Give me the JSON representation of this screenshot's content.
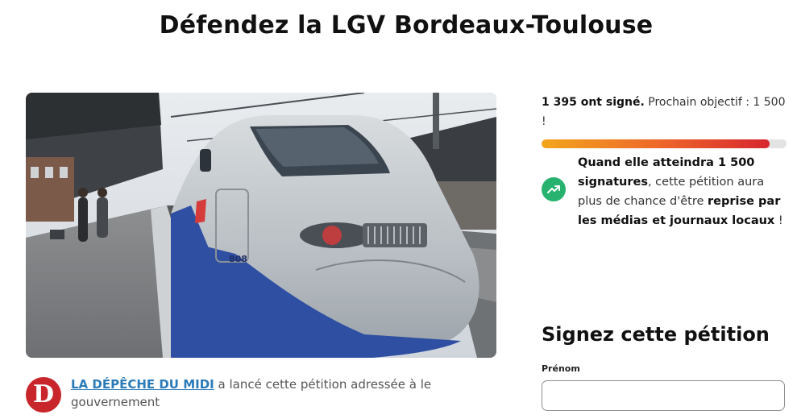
{
  "page": {
    "title": "Défendez la LGV Bordeaux-Toulouse"
  },
  "image": {
    "alt": "TGV à quai en gare",
    "train_number": "808"
  },
  "starter": {
    "logo_letter": "D",
    "organization": "LA DÉPÊCHE DU MIDI",
    "text": " a lancé cette pétition adressée à le gouvernement"
  },
  "signatures": {
    "count_label": "1 395 ont signé.",
    "goal_label": " Prochain objectif : 1 500 !",
    "progress_fraction": 0.93
  },
  "info": {
    "icon": "trending-up-icon",
    "part1_bold": "Quand elle atteindra 1 500 signatures",
    "part2": ", cette pétition aura plus de chance d'être ",
    "part3_bold": "reprise par les médias et journaux locaux",
    "part4": " !"
  },
  "form": {
    "heading": "Signez cette pétition",
    "firstname_label": "Prénom",
    "firstname_value": ""
  },
  "colors": {
    "accent_green": "#27b36f",
    "link_blue": "#2b7bb9",
    "logo_red": "#c8262a"
  }
}
